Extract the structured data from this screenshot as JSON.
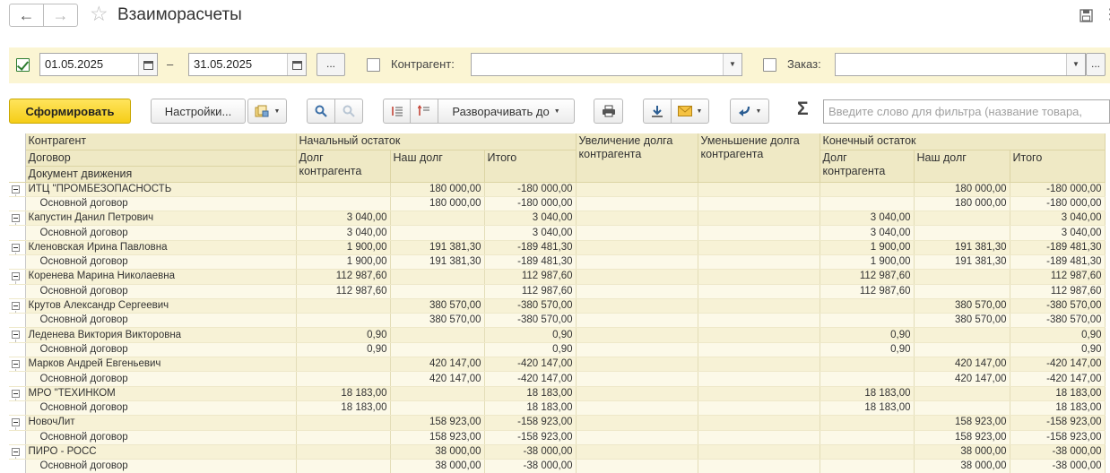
{
  "window": {
    "title": "Взаиморасчеты"
  },
  "nav": {
    "back": "←",
    "forward": "→",
    "star": "☆"
  },
  "filters": {
    "period_enabled": true,
    "date_from": "01.05.2025",
    "dash": "–",
    "date_to": "31.05.2025",
    "ellipsis": "...",
    "counterparty_label": "Контрагент:",
    "counterparty_value": "",
    "order_label": "Заказ:",
    "order_value": ""
  },
  "toolbar": {
    "generate": "Сформировать",
    "settings": "Настройки...",
    "expand_to": "Разворачивать до",
    "sigma": "Σ",
    "filter_placeholder": "Введите слово для фильтра (название товара,"
  },
  "table": {
    "header": {
      "counterparty": "Контрагент",
      "contract": "Договор",
      "document": "Документ движения",
      "opening": "Начальный остаток",
      "debt_cp": "Долг контрагента",
      "our_debt": "Наш долг",
      "total": "Итого",
      "increase": "Увеличение долга контрагента",
      "decrease": "Уменьшение долга контрагента",
      "closing": "Конечный остаток"
    },
    "rows": [
      {
        "type": "group",
        "name": "ИТЦ \"ПРОМБЕЗОПАСНОСТЬ",
        "o_debt": "",
        "o_our": "180 000,00",
        "o_total": "-180 000,00",
        "inc": "",
        "dec": "",
        "c_debt": "",
        "c_our": "180 000,00",
        "c_total": "-180 000,00"
      },
      {
        "type": "sub",
        "name": "Основной договор",
        "o_debt": "",
        "o_our": "180 000,00",
        "o_total": "-180 000,00",
        "inc": "",
        "dec": "",
        "c_debt": "",
        "c_our": "180 000,00",
        "c_total": "-180 000,00"
      },
      {
        "type": "group",
        "name": "Капустин Данил Петрович",
        "o_debt": "3 040,00",
        "o_our": "",
        "o_total": "3 040,00",
        "inc": "",
        "dec": "",
        "c_debt": "3 040,00",
        "c_our": "",
        "c_total": "3 040,00"
      },
      {
        "type": "sub",
        "name": "Основной договор",
        "o_debt": "3 040,00",
        "o_our": "",
        "o_total": "3 040,00",
        "inc": "",
        "dec": "",
        "c_debt": "3 040,00",
        "c_our": "",
        "c_total": "3 040,00"
      },
      {
        "type": "group",
        "name": "Кленовская Ирина Павловна",
        "o_debt": "1 900,00",
        "o_our": "191 381,30",
        "o_total": "-189 481,30",
        "inc": "",
        "dec": "",
        "c_debt": "1 900,00",
        "c_our": "191 381,30",
        "c_total": "-189 481,30"
      },
      {
        "type": "sub",
        "name": "Основной договор",
        "o_debt": "1 900,00",
        "o_our": "191 381,30",
        "o_total": "-189 481,30",
        "inc": "",
        "dec": "",
        "c_debt": "1 900,00",
        "c_our": "191 381,30",
        "c_total": "-189 481,30"
      },
      {
        "type": "group",
        "name": "Коренева Марина Николаевна",
        "o_debt": "112 987,60",
        "o_our": "",
        "o_total": "112 987,60",
        "inc": "",
        "dec": "",
        "c_debt": "112 987,60",
        "c_our": "",
        "c_total": "112 987,60"
      },
      {
        "type": "sub",
        "name": "Основной договор",
        "o_debt": "112 987,60",
        "o_our": "",
        "o_total": "112 987,60",
        "inc": "",
        "dec": "",
        "c_debt": "112 987,60",
        "c_our": "",
        "c_total": "112 987,60"
      },
      {
        "type": "group",
        "name": "Крутов Александр Сергеевич",
        "o_debt": "",
        "o_our": "380 570,00",
        "o_total": "-380 570,00",
        "inc": "",
        "dec": "",
        "c_debt": "",
        "c_our": "380 570,00",
        "c_total": "-380 570,00"
      },
      {
        "type": "sub",
        "name": "Основной договор",
        "o_debt": "",
        "o_our": "380 570,00",
        "o_total": "-380 570,00",
        "inc": "",
        "dec": "",
        "c_debt": "",
        "c_our": "380 570,00",
        "c_total": "-380 570,00"
      },
      {
        "type": "group",
        "name": "Леденева Виктория Викторовна",
        "o_debt": "0,90",
        "o_our": "",
        "o_total": "0,90",
        "inc": "",
        "dec": "",
        "c_debt": "0,90",
        "c_our": "",
        "c_total": "0,90"
      },
      {
        "type": "sub",
        "name": "Основной договор",
        "o_debt": "0,90",
        "o_our": "",
        "o_total": "0,90",
        "inc": "",
        "dec": "",
        "c_debt": "0,90",
        "c_our": "",
        "c_total": "0,90"
      },
      {
        "type": "group",
        "name": "Марков Андрей Евгеньевич",
        "o_debt": "",
        "o_our": "420 147,00",
        "o_total": "-420 147,00",
        "inc": "",
        "dec": "",
        "c_debt": "",
        "c_our": "420 147,00",
        "c_total": "-420 147,00"
      },
      {
        "type": "sub",
        "name": "Основной договор",
        "o_debt": "",
        "o_our": "420 147,00",
        "o_total": "-420 147,00",
        "inc": "",
        "dec": "",
        "c_debt": "",
        "c_our": "420 147,00",
        "c_total": "-420 147,00"
      },
      {
        "type": "group",
        "name": "МРО \"ТЕХИНКОМ",
        "o_debt": "18 183,00",
        "o_our": "",
        "o_total": "18 183,00",
        "inc": "",
        "dec": "",
        "c_debt": "18 183,00",
        "c_our": "",
        "c_total": "18 183,00"
      },
      {
        "type": "sub",
        "name": "Основной договор",
        "o_debt": "18 183,00",
        "o_our": "",
        "o_total": "18 183,00",
        "inc": "",
        "dec": "",
        "c_debt": "18 183,00",
        "c_our": "",
        "c_total": "18 183,00"
      },
      {
        "type": "group",
        "name": "НовочЛит",
        "o_debt": "",
        "o_our": "158 923,00",
        "o_total": "-158 923,00",
        "inc": "",
        "dec": "",
        "c_debt": "",
        "c_our": "158 923,00",
        "c_total": "-158 923,00"
      },
      {
        "type": "sub",
        "name": "Основной договор",
        "o_debt": "",
        "o_our": "158 923,00",
        "o_total": "-158 923,00",
        "inc": "",
        "dec": "",
        "c_debt": "",
        "c_our": "158 923,00",
        "c_total": "-158 923,00"
      },
      {
        "type": "group",
        "name": "ПИРО - РОСС",
        "o_debt": "",
        "o_our": "38 000,00",
        "o_total": "-38 000,00",
        "inc": "",
        "dec": "",
        "c_debt": "",
        "c_our": "38 000,00",
        "c_total": "-38 000,00"
      },
      {
        "type": "sub",
        "name": "Основной договор",
        "o_debt": "",
        "o_our": "38 000,00",
        "o_total": "-38 000,00",
        "inc": "",
        "dec": "",
        "c_debt": "",
        "c_our": "38 000,00",
        "c_total": "-38 000,00"
      }
    ]
  }
}
